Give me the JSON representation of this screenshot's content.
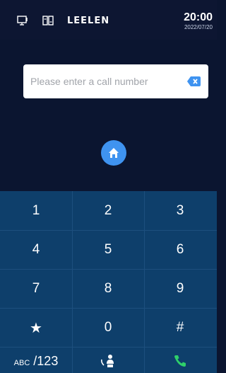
{
  "status_bar": {
    "icons": [
      "monitor-icon",
      "intercom-icon"
    ],
    "brand": "LEELEN",
    "time": "20:00",
    "date": "2022/07/20"
  },
  "input": {
    "value": "",
    "placeholder": "Please enter a call number",
    "backspace_icon": "backspace-icon"
  },
  "home": {
    "icon": "home-icon"
  },
  "keypad": {
    "keys": [
      "1",
      "2",
      "3",
      "4",
      "5",
      "6",
      "7",
      "8",
      "9",
      "★",
      "0",
      "#"
    ],
    "abc_prefix": "ABC",
    "abc_suffix": "/123",
    "contact_icon": "contact-call-icon",
    "call_icon": "phone-call-icon"
  },
  "colors": {
    "background": "#0b1530",
    "keypad": "#0e3f6b",
    "accent": "#3f93f0",
    "call_green": "#2fd06a"
  }
}
